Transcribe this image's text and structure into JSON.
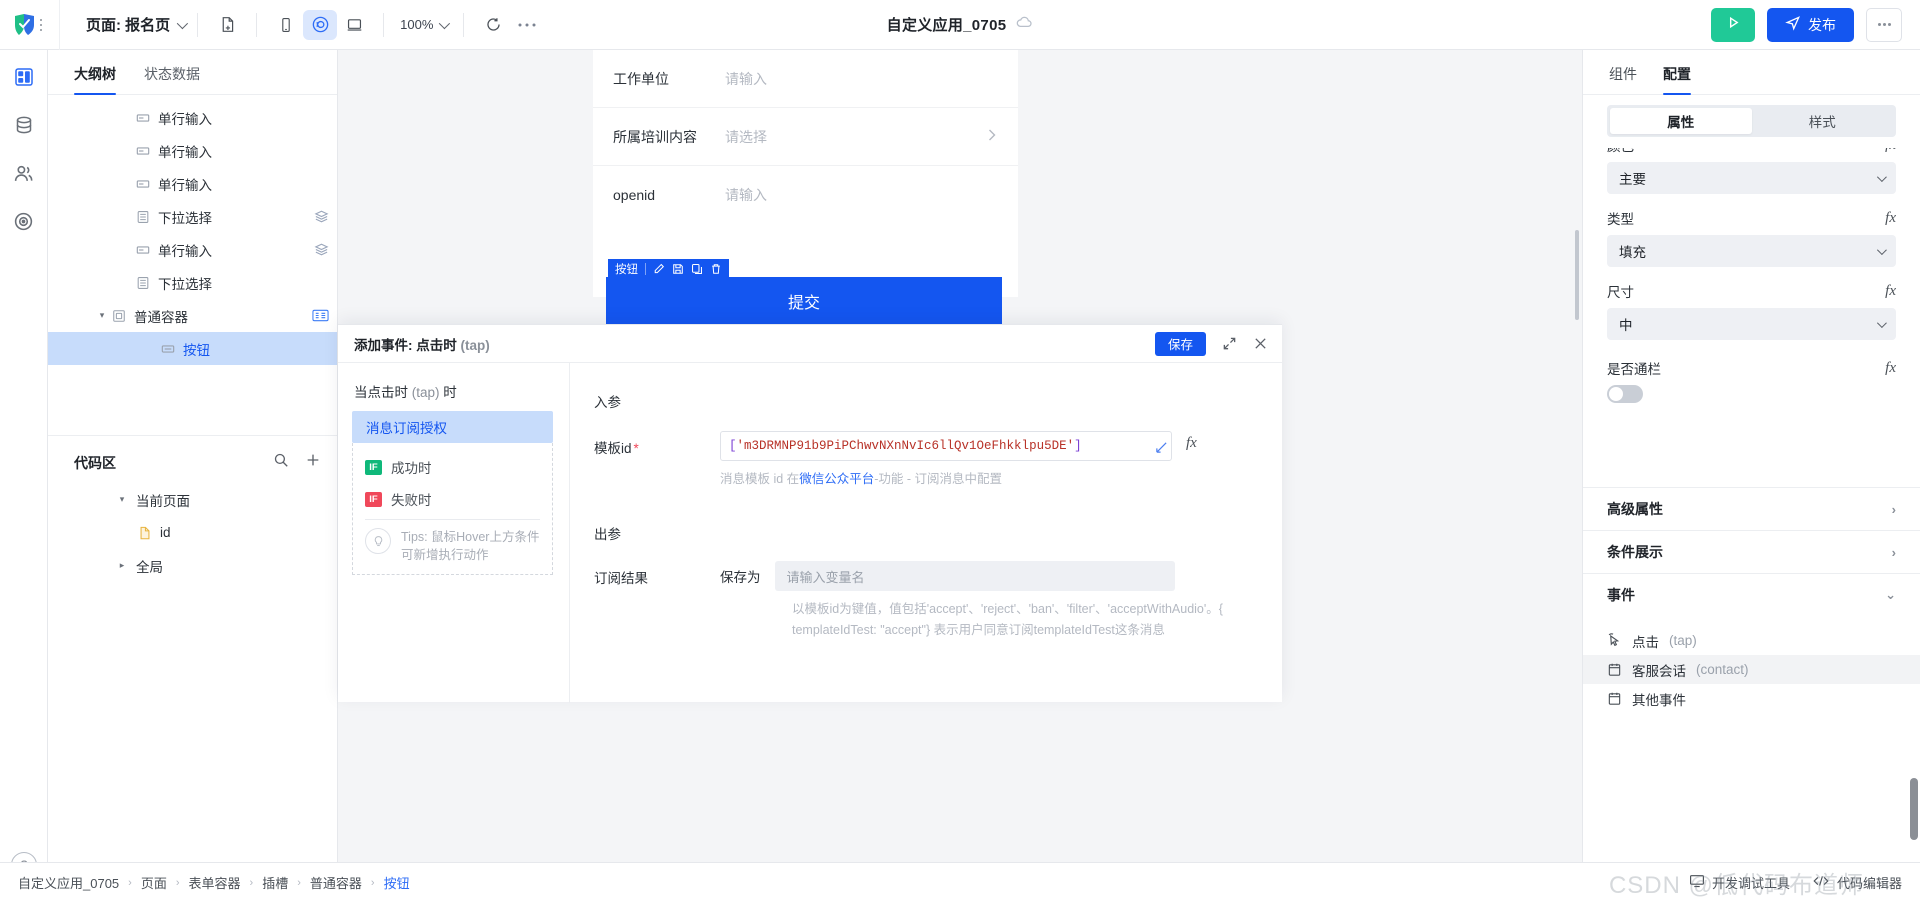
{
  "topbar": {
    "logo_icon": "app-logo-icon",
    "grip_icon": "grip-dots-icon",
    "page_label": "页面: 报名页",
    "new_page_icon": "file-plus-icon",
    "device_phone_icon": "mobile-device-icon",
    "device_mini_icon": "miniprogram-icon",
    "device_desktop_icon": "desktop-device-icon",
    "zoom_level": "100%",
    "refresh_icon": "refresh-icon",
    "more_icon": "ellipsis-icon",
    "app_title": "自定义应用_0705",
    "cloud_icon": "cloud-icon",
    "run_icon": "play-icon",
    "publish_label": "发布",
    "publish_icon": "send-icon",
    "overflow_icon": "ellipsis-icon"
  },
  "rail": {
    "items": [
      {
        "icon": "layout-blocks-icon",
        "active": true
      },
      {
        "icon": "database-icon",
        "active": false
      },
      {
        "icon": "users-icon",
        "active": false
      },
      {
        "icon": "target-icon",
        "active": false
      }
    ],
    "help_label": "?"
  },
  "outline": {
    "tabs": [
      {
        "label": "大纲树",
        "active": true
      },
      {
        "label": "状态数据",
        "active": false
      }
    ],
    "tree": [
      {
        "label": "单行输入",
        "icon": "input-field-icon",
        "indent": 2,
        "badge": "",
        "selected": false,
        "caret": ""
      },
      {
        "label": "单行输入",
        "icon": "input-field-icon",
        "indent": 2,
        "badge": "",
        "selected": false,
        "caret": ""
      },
      {
        "label": "单行输入",
        "icon": "input-field-icon",
        "indent": 2,
        "badge": "",
        "selected": false,
        "caret": ""
      },
      {
        "label": "下拉选择",
        "icon": "select-list-icon",
        "indent": 2,
        "badge": "layers-icon",
        "selected": false,
        "caret": ""
      },
      {
        "label": "单行输入",
        "icon": "input-field-icon",
        "indent": 2,
        "badge": "layers-icon",
        "selected": false,
        "caret": ""
      },
      {
        "label": "下拉选择",
        "icon": "select-list-icon",
        "indent": 2,
        "badge": "",
        "selected": false,
        "caret": ""
      },
      {
        "label": "普通容器",
        "icon": "container-icon",
        "indent": 1,
        "badge": "slot-badge",
        "selected": false,
        "caret": "down"
      },
      {
        "label": "按钮",
        "icon": "button-icon",
        "indent": 2,
        "badge": "",
        "selected": true,
        "caret": ""
      }
    ]
  },
  "codearea": {
    "title": "代码区",
    "search_icon": "search-icon",
    "add_icon": "plus-icon",
    "items": [
      {
        "label": "当前页面",
        "caret": "down",
        "icon": "",
        "indent": 1
      },
      {
        "label": "id",
        "caret": "",
        "icon": "js-file-icon",
        "indent": 2
      },
      {
        "label": "全局",
        "caret": "right",
        "icon": "",
        "indent": 1
      }
    ]
  },
  "canvas": {
    "form_rows": [
      {
        "label": "工作单位",
        "value": "请输入",
        "chevron": false
      },
      {
        "label": "所属培训内容",
        "value": "请选择",
        "chevron": true
      },
      {
        "label": "openid",
        "value": "请输入",
        "chevron": false
      }
    ],
    "submit_label": "提交",
    "selection_tag": {
      "label": "按钮",
      "icons": [
        "edit-icon",
        "save-icon",
        "copy-icon",
        "delete-icon"
      ]
    }
  },
  "modal": {
    "title": "添加事件: 点击时",
    "title_event": "(tap)",
    "save_label": "保存",
    "expand_icon": "expand-icon",
    "close_icon": "close-icon",
    "when_prefix": "当点击时",
    "when_event": "(tap)",
    "when_suffix": "时",
    "action_selected": "消息订阅授权",
    "conditions": [
      {
        "badge": "IF",
        "label": "成功时",
        "type": "success"
      },
      {
        "badge": "IF",
        "label": "失败时",
        "type": "fail"
      }
    ],
    "tips_icon": "lightbulb-icon",
    "tips": "Tips: 鼠标Hover上方条件可新增执行动作",
    "in_params_label": "入参",
    "template_id_label": "模板id",
    "template_id_value": "['m3DRMNP91b9PiPChwvNXnNvIc6llQv1OeFhkklpu5DE']",
    "template_id_hint_pre": "消息模板 id 在",
    "template_id_hint_link": "微信公众平台",
    "template_id_hint_post": "-功能 - 订阅消息中配置",
    "fx_label": "fx",
    "out_params_label": "出参",
    "sub_result_label": "订阅结果",
    "save_as_label": "保存为",
    "var_placeholder": "请输入变量名",
    "out_hint": "以模板id为键值，值包括'accept'、'reject'、'ban'、'filter'、'acceptWithAudio'。{ templateIdTest: \"accept\"} 表示用户同意订阅templateIdTest这条消息"
  },
  "right_panel": {
    "tabs": [
      {
        "label": "组件",
        "active": false
      },
      {
        "label": "配置",
        "active": true
      }
    ],
    "segments": [
      {
        "label": "属性",
        "active": true
      },
      {
        "label": "样式",
        "active": false
      }
    ],
    "properties": [
      {
        "label": "颜色",
        "value": "主要",
        "fx": "fx",
        "kind": "select"
      },
      {
        "label": "类型",
        "value": "填充",
        "fx": "fx",
        "kind": "select"
      },
      {
        "label": "尺寸",
        "value": "中",
        "fx": "fx",
        "kind": "select"
      },
      {
        "label": "是否通栏",
        "value": "",
        "fx": "fx",
        "kind": "toggle"
      }
    ],
    "sections": [
      {
        "label": "高级属性",
        "arrow": "right"
      },
      {
        "label": "条件展示",
        "arrow": "right"
      },
      {
        "label": "事件",
        "arrow": "down"
      }
    ],
    "events": [
      {
        "label": "点击",
        "event": "(tap)",
        "icon": "cursor-click-icon",
        "highlight": false
      },
      {
        "label": "客服会话",
        "event": "(contact)",
        "icon": "calendar-event-icon",
        "highlight": true
      },
      {
        "label": "其他事件",
        "event": "",
        "icon": "calendar-event-icon",
        "highlight": false
      }
    ]
  },
  "status_bar": {
    "breadcrumbs": [
      "自定义应用_0705",
      "页面",
      "表单容器",
      "插槽",
      "普通容器",
      "按钮"
    ],
    "debug_tool_label": "开发调试工具",
    "debug_tool_icon": "monitor-icon",
    "code_editor_label": "代码编辑器",
    "code_editor_icon": "code-tag-icon",
    "watermark": "CSDN @低代码布道师"
  }
}
